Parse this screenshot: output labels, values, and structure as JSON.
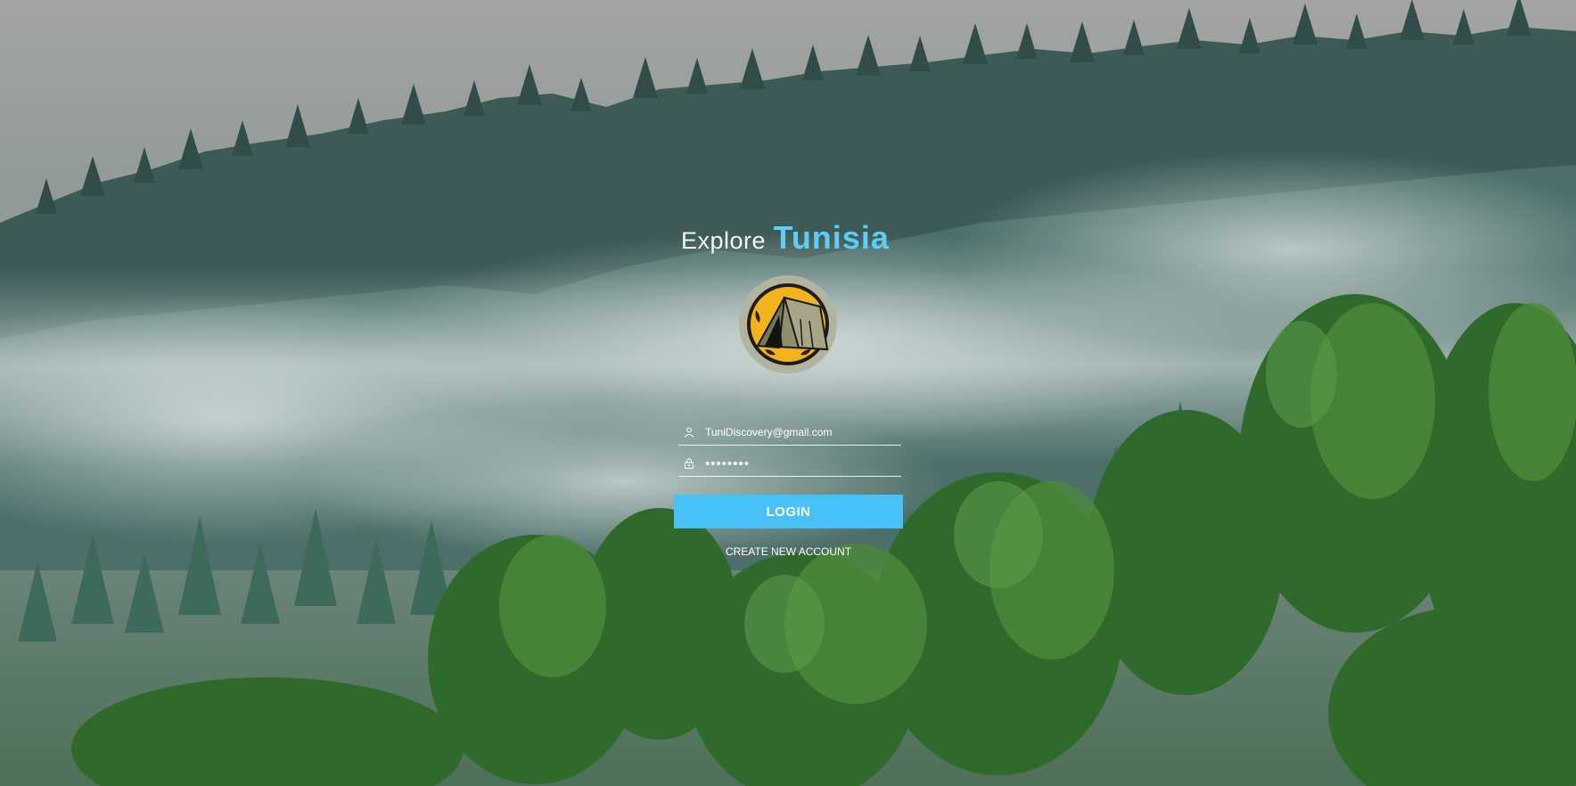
{
  "brand": {
    "prefix": "Explore",
    "name": "Tunisia",
    "accent_color": "#5fcdf2"
  },
  "logo": {
    "icon": "tent-icon"
  },
  "form": {
    "email": {
      "icon": "user-icon",
      "value": "TuniDiscovery@gmail.com"
    },
    "password": {
      "icon": "lock-icon",
      "value": "12345678"
    },
    "login_label": "LOGIN",
    "login_color": "#47c1f7",
    "create_account_label": "CREATE NEW ACCOUNT"
  },
  "background": {
    "description_icon": "misty-forest-background"
  }
}
